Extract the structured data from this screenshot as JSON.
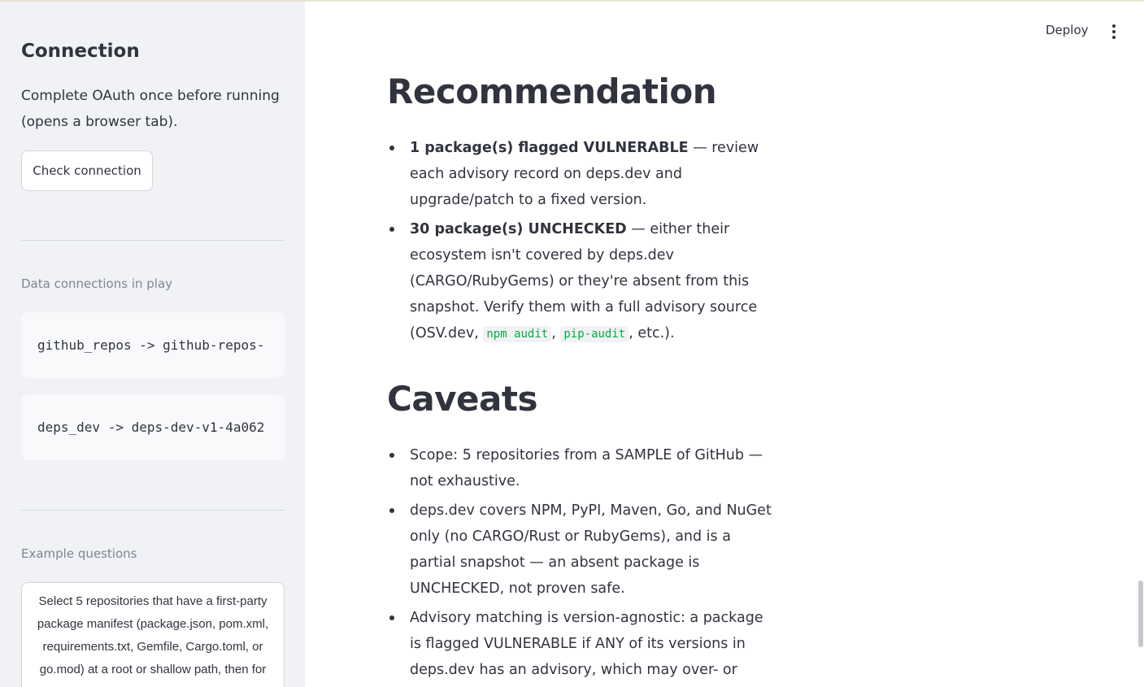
{
  "sidebar": {
    "heading": "Connection",
    "description": "Complete OAuth once before running (opens a browser tab).",
    "check_button": "Check connection",
    "data_connections_caption": "Data connections in play",
    "connections": [
      "github_repos -> github-repos-",
      "deps_dev -> deps-dev-v1-4a062"
    ],
    "examples_caption": "Example questions",
    "example_question": "Select 5 repositories that have a first-party package manifest (package.json, pom.xml, requirements.txt, Gemfile, Cargo.toml, or go.mod) at a root or shallow path, then for EACH selected"
  },
  "header": {
    "deploy_label": "Deploy",
    "menu_icon": "kebab-menu-icon"
  },
  "recommendation": {
    "title": "Recommendation",
    "items": [
      {
        "bold": "1 package(s) flagged VULNERABLE",
        "text": " — review each advisory record on deps.dev and upgrade/patch to a fixed version."
      },
      {
        "bold": "30 package(s) UNCHECKED",
        "text_before": " — either their ecosystem isn't covered by deps.dev (CARGO/RubyGems) or they're absent from this snapshot. Verify them with a full advisory source (OSV.dev, ",
        "code1": "npm audit",
        "sep": ", ",
        "code2": "pip-audit",
        "text_after": ", etc.)."
      }
    ]
  },
  "caveats": {
    "title": "Caveats",
    "items": [
      "Scope: 5 repositories from a SAMPLE of GitHub — not exhaustive.",
      "deps.dev covers NPM, PyPI, Maven, Go, and NuGet only (no CARGO/Rust or RubyGems), and is a partial snapshot — an absent package is UNCHECKED, not proven safe.",
      "Advisory matching is version-agnostic: a package is flagged VULNERABLE if ANY of its versions in deps.dev has an advisory, which may over- or under-state the"
    ]
  },
  "colors": {
    "sidebar_bg": "#f0f2f6",
    "text": "#31333f",
    "code_accent": "#09ab3b",
    "muted": "#808495"
  }
}
